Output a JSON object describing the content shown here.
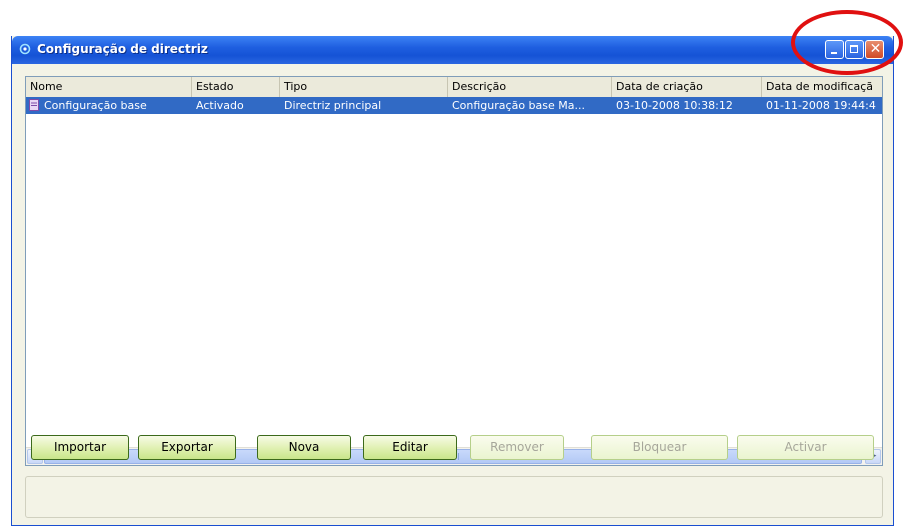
{
  "window": {
    "title": "Configuração de directriz"
  },
  "table": {
    "columns": [
      "Nome",
      "Estado",
      "Tipo",
      "Descrição",
      "Data de criação",
      "Data de modificaçã"
    ],
    "rows": [
      {
        "name": "Configuração base",
        "state": "Activado",
        "type": "Directriz principal",
        "description": "Configuração base Ma...",
        "created": "03-10-2008 10:38:12",
        "modified": "01-11-2008 19:44:4"
      }
    ]
  },
  "buttons": {
    "importar": "Importar",
    "exportar": "Exportar",
    "nova": "Nova",
    "editar": "Editar",
    "remover": "Remover",
    "bloquear": "Bloquear",
    "activar": "Activar"
  },
  "colors": {
    "titlebar": "#1f5fe0",
    "selection": "#316ac5",
    "highlight_ring": "#e01010",
    "button_green": "#c9e68a"
  }
}
